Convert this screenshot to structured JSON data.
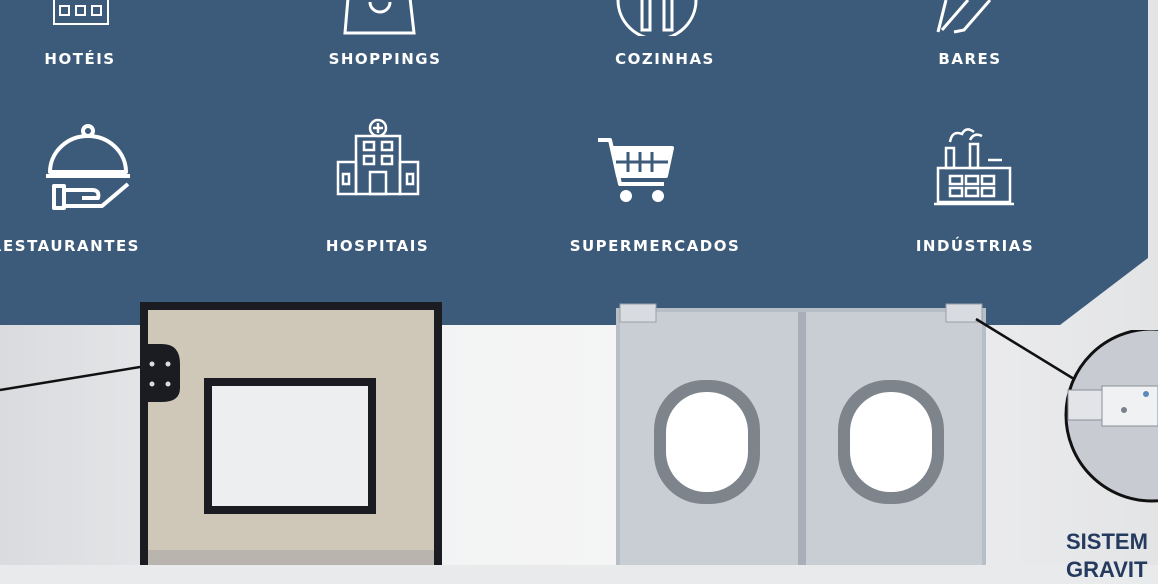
{
  "colors": {
    "panel": "#3c5a7a",
    "icon": "#ffffff",
    "caption": "#243a5e"
  },
  "categories": [
    {
      "label": "HOTÉIS",
      "icon": "hotel-icon"
    },
    {
      "label": "SHOPPINGS",
      "icon": "shopping-bag-icon"
    },
    {
      "label": "COZINHAS",
      "icon": "kitchen-icon"
    },
    {
      "label": "BARES",
      "icon": "bar-icon"
    },
    {
      "label": "RESTAURANTES",
      "icon": "cloche-icon"
    },
    {
      "label": "HOSPITAIS",
      "icon": "hospital-icon"
    },
    {
      "label": "SUPERMERCADOS",
      "icon": "cart-icon"
    },
    {
      "label": "INDÚSTRIAS",
      "icon": "factory-icon"
    }
  ],
  "caption": {
    "line1": "SISTEM",
    "line2": "GRAVIT"
  }
}
